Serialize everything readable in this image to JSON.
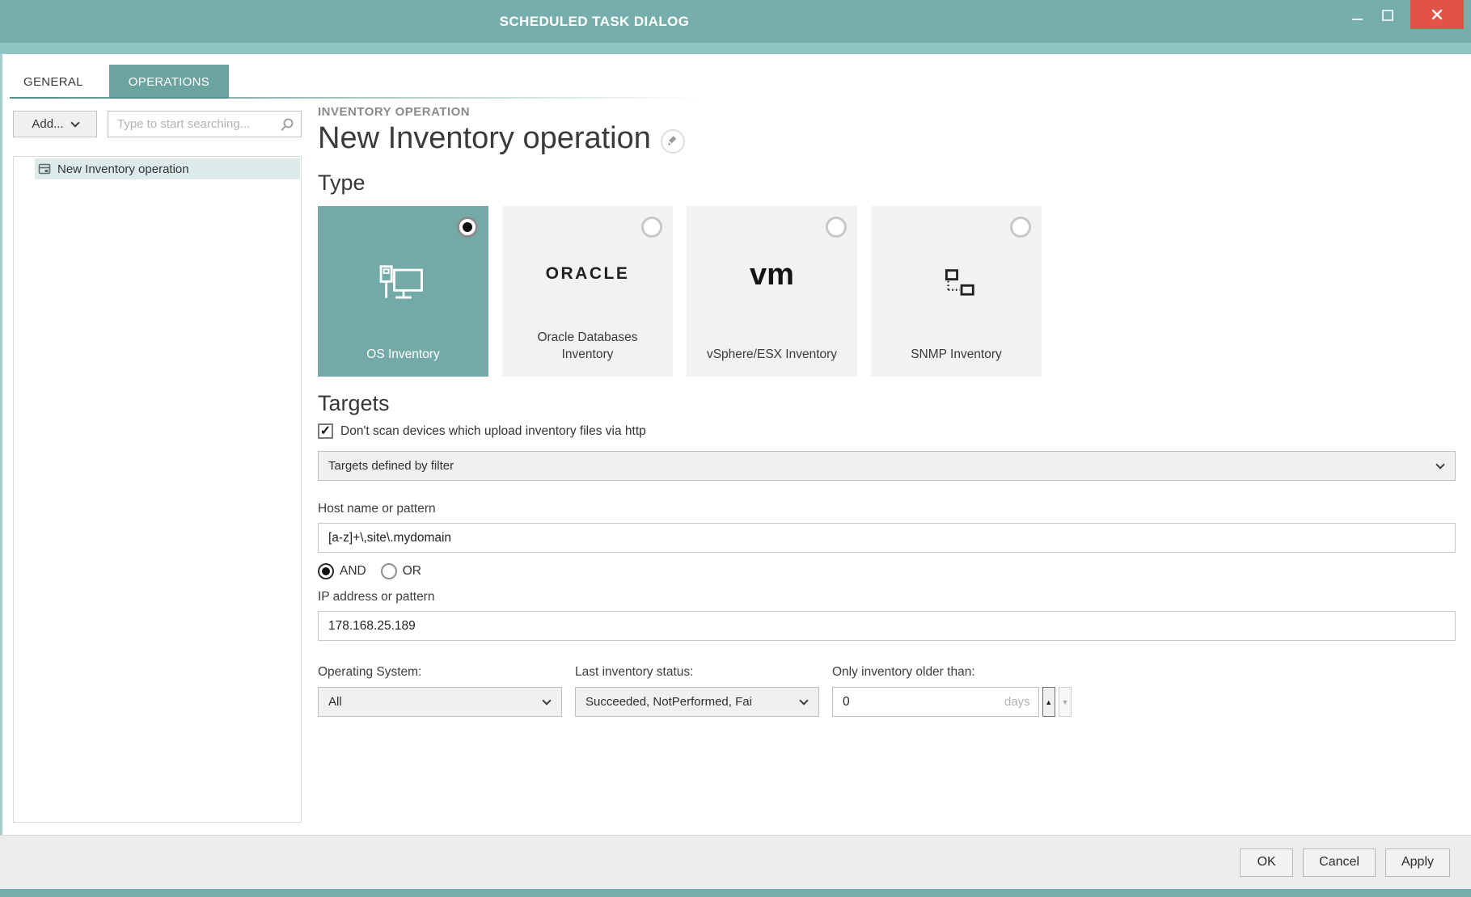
{
  "window": {
    "title": "SCHEDULED TASK DIALOG"
  },
  "tabs": {
    "general": "GENERAL",
    "operations": "OPERATIONS"
  },
  "sidebar": {
    "add_label": "Add...",
    "search_placeholder": "Type to start searching...",
    "selected_item": "New Inventory operation"
  },
  "main": {
    "kicker": "INVENTORY OPERATION",
    "title": "New Inventory operation",
    "type_heading": "Type",
    "cards": [
      {
        "label": "OS Inventory",
        "selected": true
      },
      {
        "label": "Oracle Databases Inventory",
        "logo": "ORACLE",
        "selected": false
      },
      {
        "label": "vSphere/ESX Inventory",
        "logo": "vm",
        "selected": false
      },
      {
        "label": "SNMP Inventory",
        "selected": false
      }
    ],
    "targets": {
      "heading": "Targets",
      "checkbox_label": "Don't scan devices which upload inventory files via http",
      "checkbox_checked": true,
      "check_glyph": "✓",
      "filter_value": "Targets defined by filter",
      "host_label": "Host name or pattern",
      "host_value": "[a-z]+\\,site\\.mydomain",
      "and_label": "AND",
      "or_label": "OR",
      "ip_label": "IP address or pattern",
      "ip_value": "178.168.25.189",
      "os_label": "Operating System:",
      "os_value": "All",
      "status_label": "Last inventory status:",
      "status_value": "Succeeded, NotPerformed, Fai",
      "older_label": "Only inventory older than:",
      "older_value": "0",
      "older_unit": "days",
      "spin_up_glyph": "▲",
      "spin_down_glyph": "▼"
    }
  },
  "footer": {
    "ok": "OK",
    "cancel": "Cancel",
    "apply": "Apply"
  },
  "colors": {
    "titlebar_teal": "#76aeab",
    "strip_teal": "#8fc6c2",
    "tab_teal": "#6ba39f",
    "card_teal": "#73a9a6",
    "selection_mint": "#dcebe9",
    "close_red": "#e15349",
    "footer_gray": "#ededed"
  }
}
